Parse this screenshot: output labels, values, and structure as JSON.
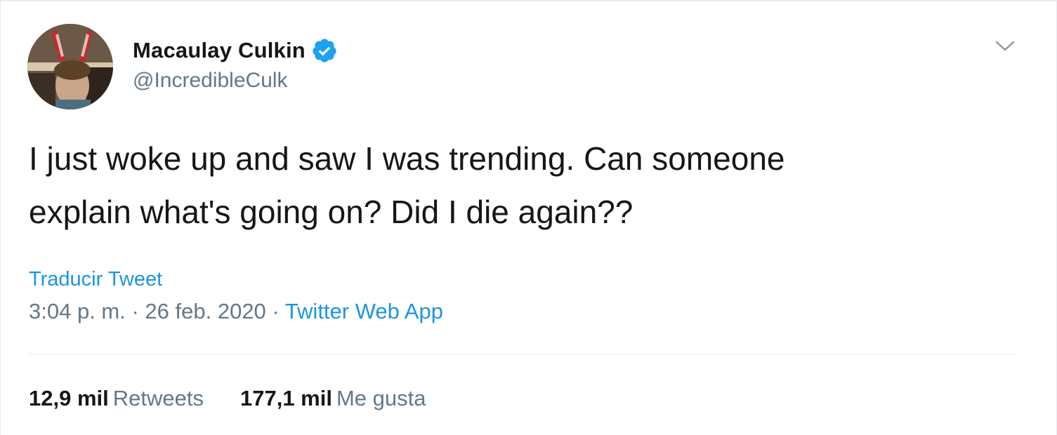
{
  "author": {
    "display_name": "Macaulay Culkin",
    "handle": "@IncredibleCulk",
    "verified": true,
    "avatar_icon": "profile-photo"
  },
  "tweet": {
    "text_line1": "I just woke up and saw I was trending. Can someone",
    "text_line2": "explain what's going on? Did I die again??",
    "translate_label": "Traducir Tweet",
    "time": "3:04 p. m.",
    "separator": " · ",
    "date": "26 feb. 2020",
    "source": "Twitter Web App"
  },
  "stats": {
    "retweets_count": "12,9 mil",
    "retweets_label": "Retweets",
    "likes_count": "177,1 mil",
    "likes_label": "Me gusta"
  },
  "colors": {
    "link": "#1b95e0",
    "secondary_text": "#657786",
    "primary_text": "#14171a",
    "verified_badge": "#1da1f2"
  }
}
